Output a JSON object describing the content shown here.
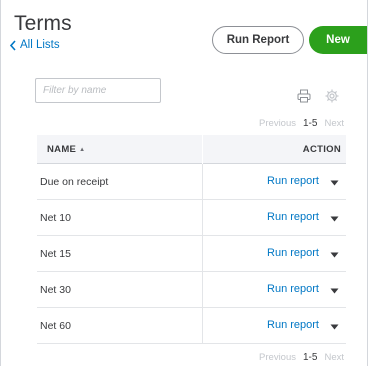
{
  "header": {
    "title": "Terms",
    "back_label": "All Lists",
    "run_report_label": "Run Report",
    "new_label": "New"
  },
  "filter": {
    "placeholder": "Filter by name"
  },
  "pager": {
    "previous": "Previous",
    "range": "1-5",
    "next": "Next"
  },
  "table": {
    "columns": {
      "name": "NAME",
      "action": "ACTION"
    },
    "sort_indicator": "▲",
    "rows": [
      {
        "name": "Due on receipt",
        "action": "Run report"
      },
      {
        "name": "Net 10",
        "action": "Run report"
      },
      {
        "name": "Net 15",
        "action": "Run report"
      },
      {
        "name": "Net 30",
        "action": "Run report"
      },
      {
        "name": "Net 60",
        "action": "Run report"
      }
    ]
  },
  "icons": {
    "back": "chevron-left-icon",
    "print": "printer-icon",
    "settings": "gear-icon",
    "row_menu": "caret-down-icon"
  },
  "colors": {
    "accent_link": "#0077c5",
    "primary_button": "#2ca01c",
    "text": "#393a3d"
  }
}
